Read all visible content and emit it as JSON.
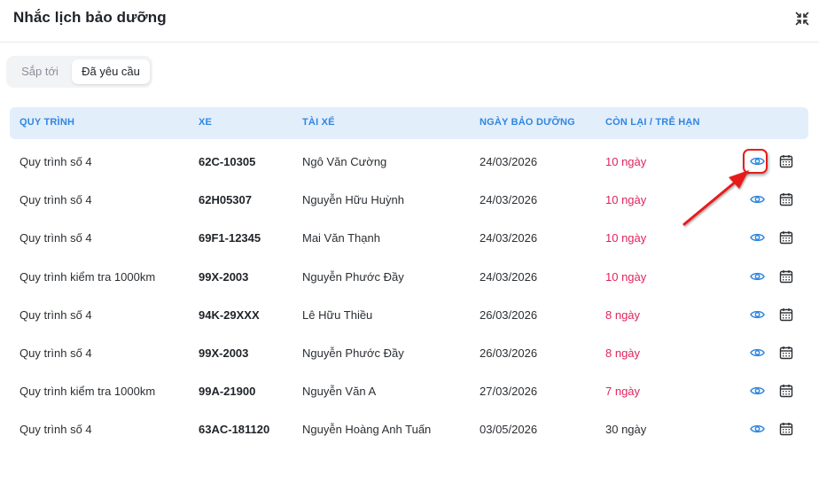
{
  "dialog": {
    "title": "Nhắc lịch bảo dưỡng",
    "collapse_icon": "collapse-arrows-icon"
  },
  "tabs": [
    {
      "label": "Sắp tới",
      "active": false
    },
    {
      "label": "Đã yêu cầu",
      "active": true
    }
  ],
  "table": {
    "headers": {
      "procedure": "QUY TRÌNH",
      "vehicle": "XE",
      "driver": "TÀI XẾ",
      "date": "NGÀY BẢO DƯỠNG",
      "remaining": "CÒN LẠI / TRỄ HẠN"
    },
    "rows": [
      {
        "procedure": "Quy trình số 4",
        "vehicle": "62C-10305",
        "driver": "Ngô Văn Cường",
        "date": "24/03/2026",
        "remaining": "10 ngày",
        "overdue": true
      },
      {
        "procedure": "Quy trình số 4",
        "vehicle": "62H05307",
        "driver": "Nguyễn Hữu Huỳnh",
        "date": "24/03/2026",
        "remaining": "10 ngày",
        "overdue": true
      },
      {
        "procedure": "Quy trình số 4",
        "vehicle": "69F1-12345",
        "driver": "Mai Văn Thạnh",
        "date": "24/03/2026",
        "remaining": "10 ngày",
        "overdue": true
      },
      {
        "procedure": "Quy trình kiểm tra 1000km",
        "vehicle": "99X-2003",
        "driver": "Nguyễn Phước Đầy",
        "date": "24/03/2026",
        "remaining": "10 ngày",
        "overdue": true
      },
      {
        "procedure": "Quy trình số 4",
        "vehicle": "94K-29XXX",
        "driver": "Lê Hữu Thiều",
        "date": "26/03/2026",
        "remaining": "8 ngày",
        "overdue": true
      },
      {
        "procedure": "Quy trình số 4",
        "vehicle": "99X-2003",
        "driver": "Nguyễn Phước Đầy",
        "date": "26/03/2026",
        "remaining": "8 ngày",
        "overdue": true
      },
      {
        "procedure": "Quy trình kiểm tra 1000km",
        "vehicle": "99A-21900",
        "driver": "Nguyễn Văn A",
        "date": "27/03/2026",
        "remaining": "7 ngày",
        "overdue": true
      },
      {
        "procedure": "Quy trình số 4",
        "vehicle": "63AC-181120",
        "driver": "Nguyễn Hoàng Anh Tuấn",
        "date": "03/05/2026",
        "remaining": "30 ngày",
        "overdue": false
      }
    ],
    "row_actions": [
      "eye-icon",
      "calendar-icon"
    ]
  },
  "colors": {
    "accent": "#2f86e0",
    "header_bg": "#e3eefb",
    "overdue": "#e0245e",
    "annotation": "#e61e1e"
  }
}
